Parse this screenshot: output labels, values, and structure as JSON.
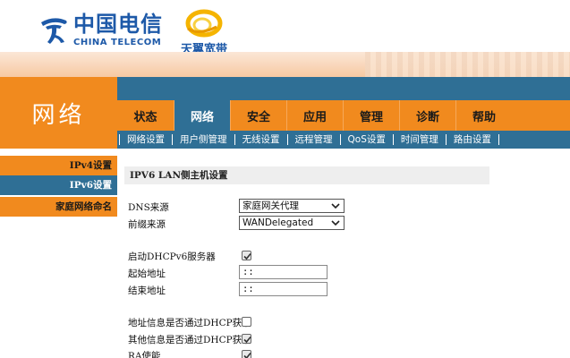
{
  "header": {
    "logo_cn": "中国电信",
    "logo_en": "CHINA TELECOM",
    "brand2": "天翼宽带"
  },
  "side_title": "网络",
  "tabs": [
    {
      "label": "状态",
      "active": false
    },
    {
      "label": "网络",
      "active": true
    },
    {
      "label": "安全",
      "active": false
    },
    {
      "label": "应用",
      "active": false
    },
    {
      "label": "管理",
      "active": false
    },
    {
      "label": "诊断",
      "active": false
    },
    {
      "label": "帮助",
      "active": false
    }
  ],
  "subnav": [
    "网络设置",
    "用户侧管理",
    "无线设置",
    "远程管理",
    "QoS设置",
    "时间管理",
    "路由设置"
  ],
  "sidebar": {
    "items": [
      {
        "label": "IPv4设置"
      },
      {
        "label": "IPv6设置"
      },
      {
        "label": "家庭网络命名"
      }
    ]
  },
  "section": {
    "title": "IPV6 LAN侧主机设置",
    "dns_source": {
      "label": "DNS来源",
      "value": "家庭网关代理"
    },
    "prefix_source": {
      "label": "前缀来源",
      "value": "WANDelegated"
    },
    "dhcpv6_server": {
      "label": "启动DHCPv6服务器",
      "checked": true
    },
    "start_addr": {
      "label": "起始地址",
      "value": "::"
    },
    "end_addr": {
      "label": "结束地址",
      "value": "::"
    },
    "addr_info_dhcp": {
      "label": "地址信息是否通过DHCP获取",
      "checked": false
    },
    "other_info_dhcp": {
      "label": "其他信息是否通过DHCP获取",
      "checked": true
    },
    "ra_enable": {
      "label": "RA使能",
      "checked": true
    }
  },
  "colors": {
    "orange": "#f18a1e",
    "blue": "#2f6f95",
    "brand_blue": "#1d59a8"
  }
}
